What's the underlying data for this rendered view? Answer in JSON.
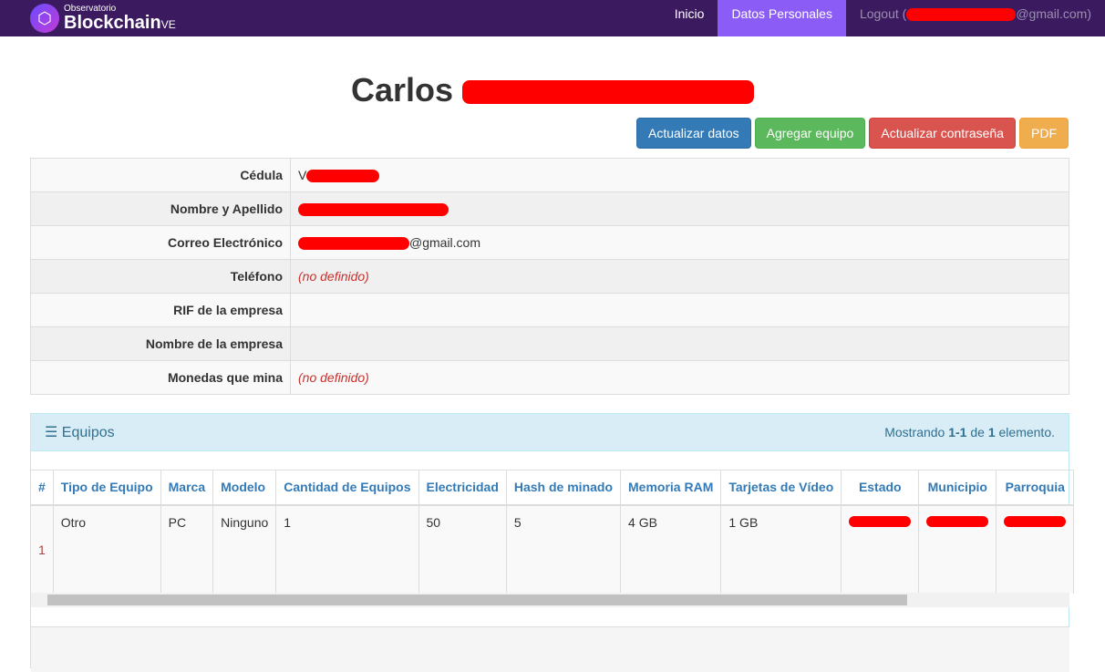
{
  "nav": {
    "brand_small": "Observatorio",
    "brand_main": "Blockchain",
    "brand_suffix": "VE",
    "inicio": "Inicio",
    "datos": "Datos Personales",
    "logout_prefix": "Logout (",
    "logout_suffix": "@gmail.com)"
  },
  "title": "Carlos",
  "buttons": {
    "actualizar": "Actualizar datos",
    "agregar": "Agregar equipo",
    "contrasena": "Actualizar contraseña",
    "pdf": "PDF"
  },
  "details": [
    {
      "label": "Cédula",
      "value": "V"
    },
    {
      "label": "Nombre y Apellido",
      "value": ""
    },
    {
      "label": "Correo Electrónico",
      "value": "@gmail.com"
    },
    {
      "label": "Teléfono",
      "value": "(no definido)"
    },
    {
      "label": "RIF de la empresa",
      "value": ""
    },
    {
      "label": "Nombre de la empresa",
      "value": ""
    },
    {
      "label": "Monedas que mina",
      "value": "(no definido)"
    }
  ],
  "panel": {
    "title": "Equipos",
    "summary_prefix": "Mostrando ",
    "range": "1-1",
    "summary_mid": " de ",
    "total": "1",
    "summary_suffix": " elemento."
  },
  "table": {
    "headers": [
      "#",
      "Tipo de Equipo",
      "Marca",
      "Modelo",
      "Cantidad de Equipos",
      "Electricidad",
      "Hash de minado",
      "Memoria RAM",
      "Tarjetas de Vídeo",
      "Estado",
      "Municipio",
      "Parroquia"
    ],
    "row": [
      "1",
      "Otro",
      "PC",
      "Ninguno",
      "1",
      "50",
      "5",
      "4 GB",
      "1 GB",
      "",
      "",
      ""
    ]
  }
}
